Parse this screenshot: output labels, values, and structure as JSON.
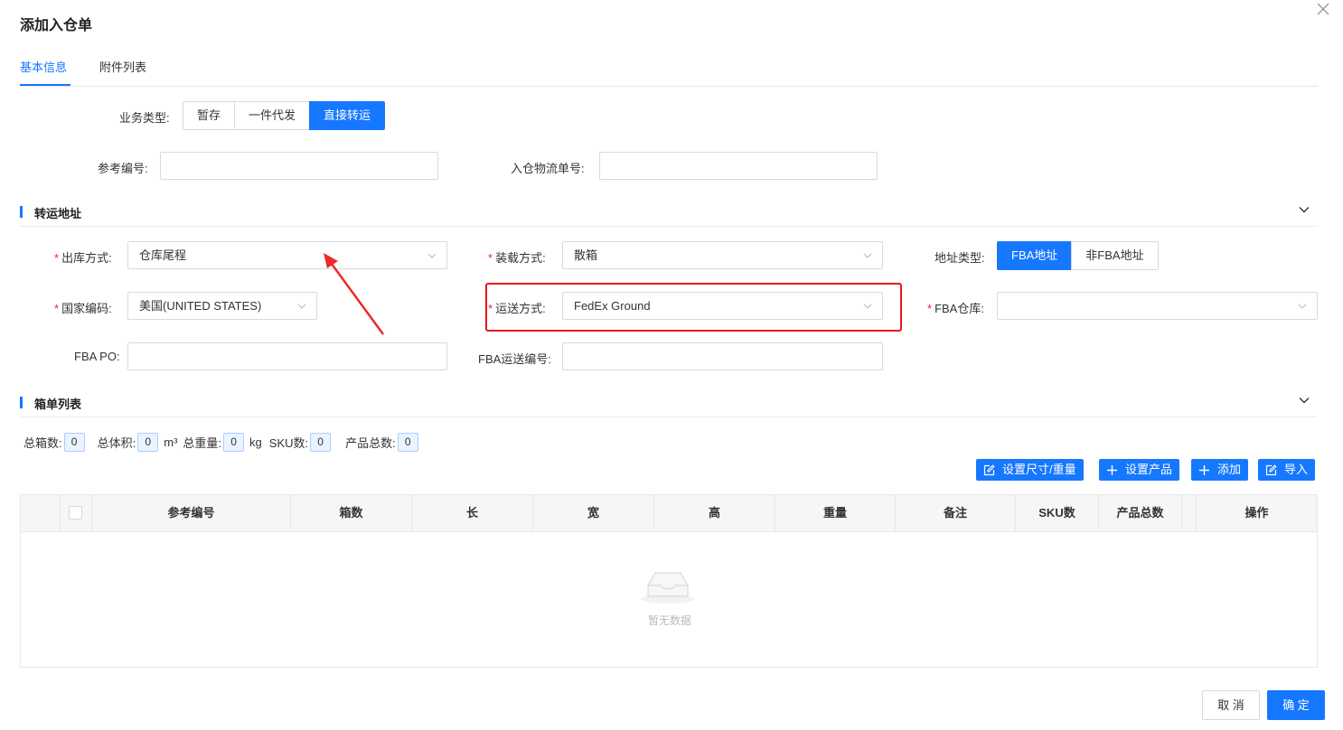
{
  "dialog": {
    "title": "添加入仓单"
  },
  "tabs": [
    {
      "label": "基本信息",
      "active": true
    },
    {
      "label": "附件列表",
      "active": false
    }
  ],
  "business_type": {
    "label": "业务类型:",
    "options": [
      "暂存",
      "一件代发",
      "直接转运"
    ],
    "selected": "直接转运"
  },
  "ref_no": {
    "label": "参考编号:",
    "value": ""
  },
  "inbound_tracking": {
    "label": "入仓物流单号:",
    "value": ""
  },
  "transfer_section": {
    "title": "转运地址"
  },
  "outbound_method": {
    "label": "出库方式:",
    "value": "仓库尾程",
    "required": true
  },
  "loading_method": {
    "label": "装载方式:",
    "value": "散箱",
    "required": true
  },
  "address_type": {
    "label": "地址类型:",
    "options": [
      "FBA地址",
      "非FBA地址"
    ],
    "selected": "FBA地址"
  },
  "country_code": {
    "label": "国家编码:",
    "value": "美国(UNITED STATES)",
    "required": true
  },
  "shipping_method": {
    "label": "运送方式:",
    "value": "FedEx Ground",
    "required": true
  },
  "fba_warehouse": {
    "label": "FBA仓库:",
    "value": "",
    "required": true
  },
  "fba_po": {
    "label": "FBA PO:",
    "value": ""
  },
  "fba_shipment_no": {
    "label": "FBA运送编号:",
    "value": ""
  },
  "box_section": {
    "title": "箱单列表"
  },
  "stats": {
    "total_boxes_label": "总箱数:",
    "total_boxes": "0",
    "total_volume_label": "总体积:",
    "total_volume": "0",
    "volume_unit": "m³",
    "total_weight_label": "总重量:",
    "total_weight": "0",
    "weight_unit": "kg",
    "sku_count_label": "SKU数:",
    "sku_count": "0",
    "product_total_label": "产品总数:",
    "product_total": "0"
  },
  "toolbar": {
    "set_size_weight": "设置尺寸/重量",
    "set_product": "设置产品",
    "add": "添加",
    "import": "导入"
  },
  "table": {
    "columns": [
      "参考编号",
      "箱数",
      "长",
      "宽",
      "高",
      "重量",
      "备注",
      "SKU数",
      "产品总数",
      "操作"
    ],
    "empty_text": "暂无数据"
  },
  "footer": {
    "cancel": "取 消",
    "confirm": "确 定"
  },
  "colors": {
    "primary": "#1677ff",
    "required": "#f5222d",
    "highlight": "#e8151b"
  }
}
